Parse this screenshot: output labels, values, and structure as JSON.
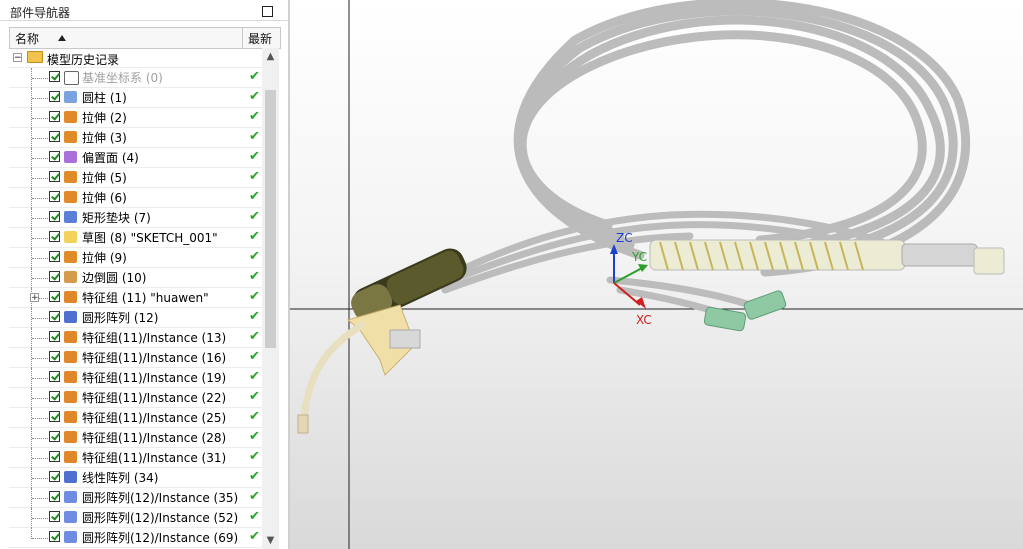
{
  "navigator": {
    "title": "部件导航器",
    "columns": {
      "name": "名称",
      "latest": "最新"
    },
    "root": {
      "label": "模型历史记录"
    },
    "items": [
      {
        "label": "基准坐标系 (0)",
        "icon": "datum-csys-icon",
        "dim": true
      },
      {
        "label": "圆柱 (1)",
        "icon": "cylinder-icon"
      },
      {
        "label": "拉伸 (2)",
        "icon": "extrude-icon"
      },
      {
        "label": "拉伸 (3)",
        "icon": "extrude-icon"
      },
      {
        "label": "偏置面 (4)",
        "icon": "offset-face-icon"
      },
      {
        "label": "拉伸 (5)",
        "icon": "extrude-icon"
      },
      {
        "label": "拉伸 (6)",
        "icon": "extrude-icon"
      },
      {
        "label": "矩形垫块 (7)",
        "icon": "pad-icon"
      },
      {
        "label": "草图 (8) \"SKETCH_001\"",
        "icon": "sketch-icon"
      },
      {
        "label": "拉伸 (9)",
        "icon": "extrude-icon"
      },
      {
        "label": "边倒圆 (10)",
        "icon": "edge-blend-icon"
      },
      {
        "label": "特征组 (11) \"huawen\"",
        "icon": "feature-group-icon",
        "expandable": true
      },
      {
        "label": "圆形阵列 (12)",
        "icon": "pattern-icon"
      },
      {
        "label": "特征组(11)/Instance (13)",
        "icon": "feature-group-icon"
      },
      {
        "label": "特征组(11)/Instance (16)",
        "icon": "feature-group-icon"
      },
      {
        "label": "特征组(11)/Instance (19)",
        "icon": "feature-group-icon"
      },
      {
        "label": "特征组(11)/Instance (22)",
        "icon": "feature-group-icon"
      },
      {
        "label": "特征组(11)/Instance (25)",
        "icon": "feature-group-icon"
      },
      {
        "label": "特征组(11)/Instance (28)",
        "icon": "feature-group-icon"
      },
      {
        "label": "特征组(11)/Instance (31)",
        "icon": "feature-group-icon"
      },
      {
        "label": "线性阵列 (34)",
        "icon": "pattern-icon"
      },
      {
        "label": "圆形阵列(12)/Instance (35)",
        "icon": "pattern-instance-icon"
      },
      {
        "label": "圆形阵列(12)/Instance (52)",
        "icon": "pattern-instance-icon"
      },
      {
        "label": "圆形阵列(12)/Instance (69)",
        "icon": "pattern-instance-icon"
      }
    ]
  },
  "viewport": {
    "axes": {
      "z": "ZC",
      "y": "YC",
      "x": "XC"
    }
  },
  "colors": {
    "z_axis": "#1f3fd0",
    "y_axis": "#2aa02a",
    "x_axis": "#d02020",
    "check": "#27a327"
  }
}
